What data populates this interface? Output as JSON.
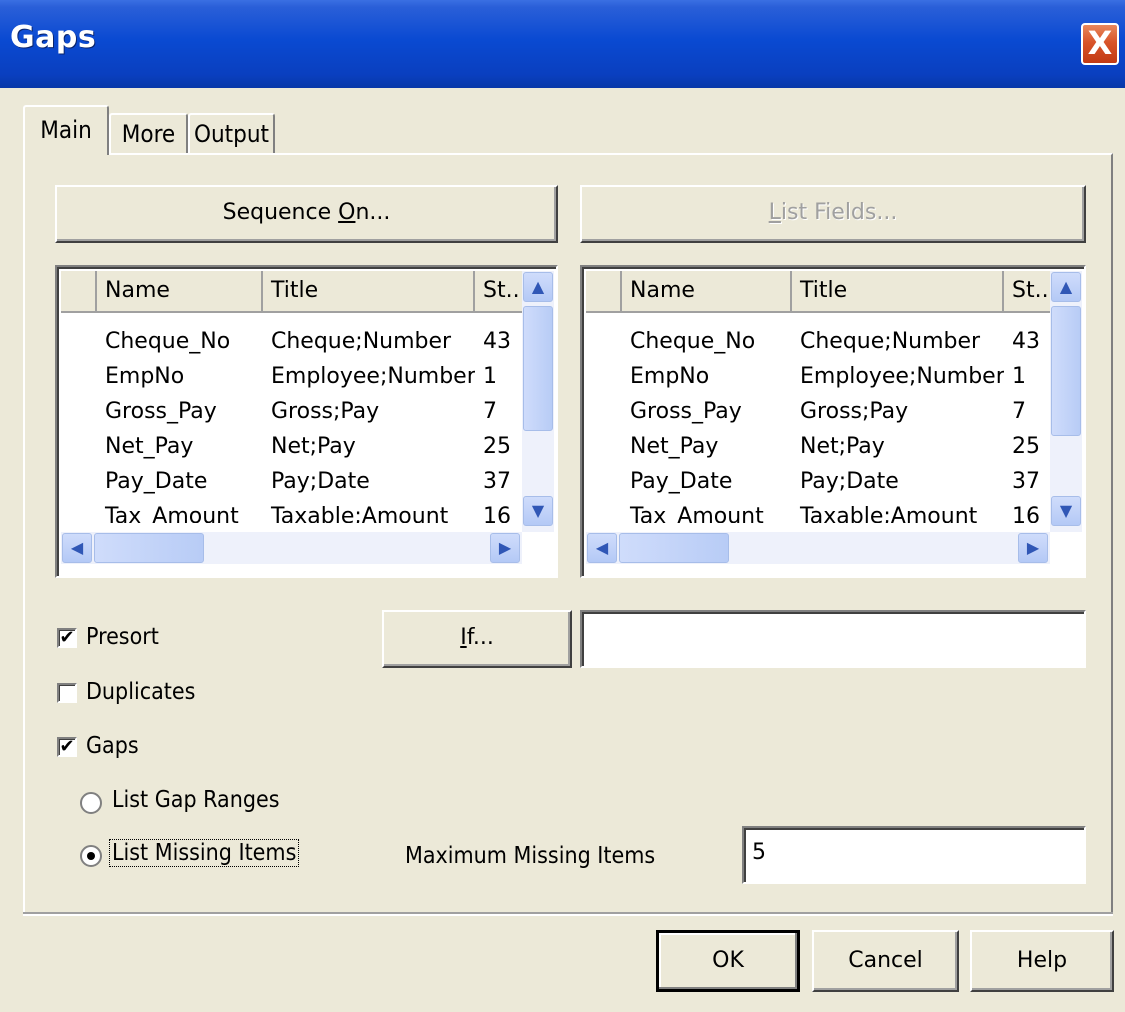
{
  "window": {
    "title": "Gaps",
    "close_glyph": "X"
  },
  "tabs": [
    {
      "label": "Main",
      "active": true
    },
    {
      "label": "More",
      "active": false
    },
    {
      "label": "Output",
      "active": false
    }
  ],
  "buttons": {
    "sequence_on": {
      "before": "Sequence ",
      "key": "O",
      "after": "n..."
    },
    "list_fields": {
      "key": "L",
      "after": "ist Fields...",
      "disabled": true
    },
    "if": {
      "key": "I",
      "after": "f..."
    },
    "ok": "OK",
    "cancel": "Cancel",
    "help": "Help"
  },
  "field_list": {
    "columns": [
      "Name",
      "Title",
      "St.."
    ],
    "rows": [
      [
        "Cheque_No",
        "Cheque;Number",
        "43"
      ],
      [
        "EmpNo",
        "Employee;Number",
        "1"
      ],
      [
        "Gross_Pay",
        "Gross;Pay",
        "7"
      ],
      [
        "Net_Pay",
        "Net;Pay",
        "25"
      ],
      [
        "Pay_Date",
        "Pay;Date",
        "37"
      ],
      [
        "Tax_Amount",
        "Taxable;Amount",
        "16"
      ]
    ]
  },
  "options": {
    "presort": {
      "label": "Presort",
      "checked": true
    },
    "duplicates": {
      "label": "Duplicates",
      "checked": false
    },
    "gaps": {
      "label": "Gaps",
      "checked": true
    },
    "list_gap_ranges": {
      "label": "List Gap Ranges",
      "selected": false
    },
    "list_missing_items": {
      "label": "List Missing Items",
      "selected": true
    }
  },
  "if_expression": "",
  "maximum_missing": {
    "label": "Maximum Missing Items",
    "value": "5"
  },
  "icons": {
    "scroll_up": "▲",
    "scroll_down": "▼",
    "scroll_left": "◀",
    "scroll_right": "▶",
    "check": "✔"
  },
  "colors": {
    "titlebar": "#0a4ad2",
    "dialog_bg": "#ece9d8",
    "close_button": "#d9542a"
  }
}
